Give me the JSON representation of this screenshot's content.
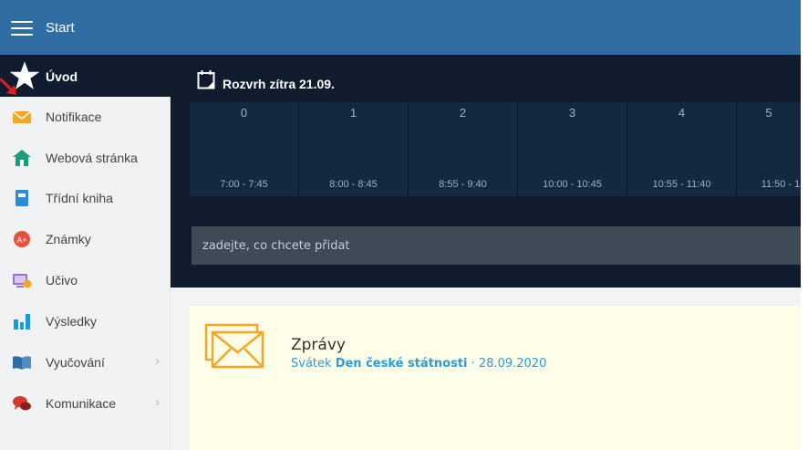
{
  "header": {
    "title": "Start"
  },
  "home": {
    "label": "Úvod"
  },
  "sidebar": {
    "items": [
      {
        "label": "Notifikace",
        "icon": "envelope-icon"
      },
      {
        "label": "Webová stránka",
        "icon": "home-icon"
      },
      {
        "label": "Třídní kniha",
        "icon": "book-icon"
      },
      {
        "label": "Známky",
        "icon": "grades-icon"
      },
      {
        "label": "Učivo",
        "icon": "monitor-icon"
      },
      {
        "label": "Výsledky",
        "icon": "bar-chart-icon"
      },
      {
        "label": "Vyučování",
        "icon": "open-book-icon",
        "chevron": "›"
      },
      {
        "label": "Komunikace",
        "icon": "chat-icon",
        "chevron": "›"
      }
    ]
  },
  "schedule": {
    "title": "Rozvrh zítra 21.09.",
    "periods": [
      {
        "num": "0",
        "time": "7:00 - 7:45"
      },
      {
        "num": "1",
        "time": "8:00 - 8:45"
      },
      {
        "num": "2",
        "time": "8:55 - 9:40"
      },
      {
        "num": "3",
        "time": "10:00 - 10:45"
      },
      {
        "num": "4",
        "time": "10:55 - 11:40"
      },
      {
        "num": "5",
        "time": "11:50 - 1"
      }
    ]
  },
  "add": {
    "placeholder": "zadejte, co chcete přidat"
  },
  "messages": {
    "title": "Zprávy",
    "prefix": "Svátek",
    "holiday": "Den české státnosti",
    "date": "· 28.09.2020"
  },
  "colors": {
    "topbar": "#2f6da3",
    "dark": "#101c2e",
    "accent_orange": "#f5a623",
    "link_blue": "#2f9bd6"
  }
}
